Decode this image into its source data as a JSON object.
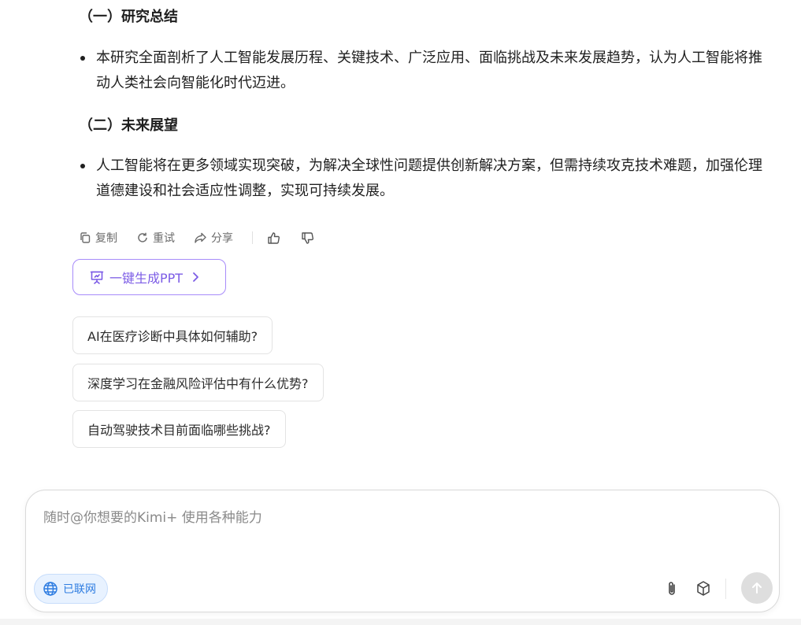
{
  "article": {
    "section1_title": "（一）研究总结",
    "section1_bullet": "本研究全面剖析了人工智能发展历程、关键技术、广泛应用、面临挑战及未来发展趋势，认为人工智能将推动人类社会向智能化时代迈进。",
    "section2_title": "（二）未来展望",
    "section2_bullet": "人工智能将在更多领域实现突破，为解决全球性问题提供创新解决方案，但需持续攻克技术难题，加强伦理道德建设和社会适应性调整，实现可持续发展。"
  },
  "actions": {
    "copy_label": "复制",
    "retry_label": "重试",
    "share_label": "分享",
    "icons": [
      "copy-icon",
      "refresh-icon",
      "share-icon",
      "thumbs-up-icon",
      "thumbs-down-icon"
    ]
  },
  "ppt_button": {
    "label": "一键生成PPT",
    "accent": "#7c5ce6"
  },
  "suggestions": [
    "AI在医疗诊断中具体如何辅助?",
    "深度学习在金融风险评估中有什么优势?",
    "自动驾驶技术目前面临哪些挑战?"
  ],
  "composer": {
    "placeholder": "随时@你想要的Kimi+ 使用各种能力",
    "value": "",
    "online_label": "已联网",
    "online_color": "#2f7de1",
    "tool_icons": [
      "paperclip-icon",
      "cube-icon",
      "send-arrow-icon"
    ]
  }
}
